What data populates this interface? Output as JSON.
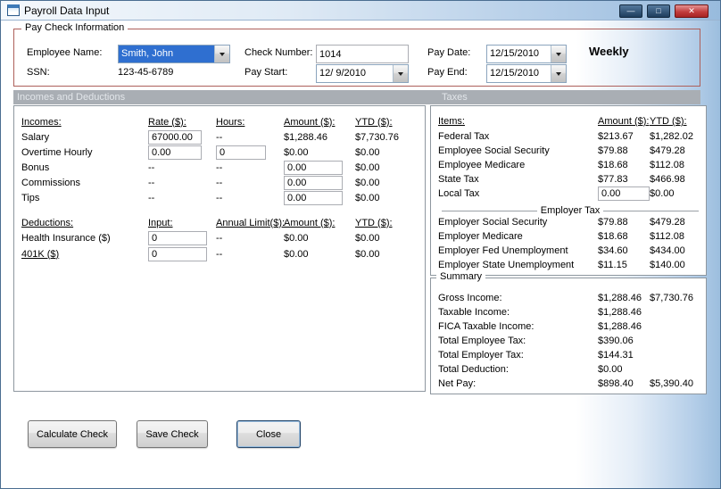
{
  "window": {
    "title": "Payroll Data Input"
  },
  "icons": {
    "minimize": "—",
    "maximize": "□",
    "close": "✕"
  },
  "paycheck": {
    "group_label": "Pay Check Information",
    "employee_name_label": "Employee Name:",
    "employee_name_value": "Smith, John",
    "ssn_label": "SSN:",
    "ssn_value": "123-45-6789",
    "check_number_label": "Check Number:",
    "check_number_value": "1014",
    "pay_start_label": "Pay Start:",
    "pay_start_value": "12/ 9/2010",
    "pay_date_label": "Pay Date:",
    "pay_date_value": "12/15/2010",
    "pay_end_label": "Pay End:",
    "pay_end_value": "12/15/2010",
    "frequency": "Weekly"
  },
  "sections": {
    "incomes_deductions": "Incomes and Deductions",
    "taxes": "Taxes"
  },
  "incomes": {
    "headers": [
      "Incomes:",
      "Rate ($):",
      "Hours:",
      "Amount ($):",
      "YTD ($):"
    ],
    "salary": {
      "label": "Salary",
      "rate": "67000.00",
      "hours": "--",
      "amount": "$1,288.46",
      "ytd": "$7,730.76"
    },
    "overtime": {
      "label": "Overtime Hourly",
      "rate": "0.00",
      "hours": "0",
      "amount": "$0.00",
      "ytd": "$0.00"
    },
    "bonus": {
      "label": "Bonus",
      "rate": "--",
      "hours": "--",
      "amount": "0.00",
      "ytd": "$0.00"
    },
    "commissions": {
      "label": "Commissions",
      "rate": "--",
      "hours": "--",
      "amount": "0.00",
      "ytd": "$0.00"
    },
    "tips": {
      "label": "Tips",
      "rate": "--",
      "hours": "--",
      "amount": "0.00",
      "ytd": "$0.00"
    }
  },
  "deductions": {
    "headers": [
      "Deductions:",
      "Input:",
      "Annual Limit($):",
      "Amount ($):",
      "YTD ($):"
    ],
    "health": {
      "label": "Health Insurance ($)",
      "input": "0",
      "limit": "--",
      "amount": "$0.00",
      "ytd": "$0.00"
    },
    "k401": {
      "label": "401K ($)",
      "input": "0",
      "limit": "--",
      "amount": "$0.00",
      "ytd": "$0.00"
    }
  },
  "taxes": {
    "headers": [
      "Items:",
      "Amount ($):",
      "YTD ($):"
    ],
    "rows": [
      {
        "label": "Federal Tax",
        "amount": "$213.67",
        "ytd": "$1,282.02"
      },
      {
        "label": "Employee Social Security",
        "amount": "$79.88",
        "ytd": "$479.28"
      },
      {
        "label": "Employee Medicare",
        "amount": "$18.68",
        "ytd": "$112.08"
      },
      {
        "label": "State Tax",
        "amount": "$77.83",
        "ytd": "$466.98"
      }
    ],
    "local_tax": {
      "label": "Local Tax",
      "amount": "0.00",
      "ytd": "$0.00"
    },
    "employer_header": "Employer Tax",
    "employer_rows": [
      {
        "label": "Employer Social Security",
        "amount": "$79.88",
        "ytd": "$479.28"
      },
      {
        "label": "Employer Medicare",
        "amount": "$18.68",
        "ytd": "$112.08"
      },
      {
        "label": "Employer Fed Unemployment",
        "amount": "$34.60",
        "ytd": "$434.00"
      },
      {
        "label": "Employer State Unemployment",
        "amount": "$11.15",
        "ytd": "$140.00"
      }
    ]
  },
  "summary": {
    "group_label": "Summary",
    "rows": [
      {
        "label": "Gross Income:",
        "amount": "$1,288.46",
        "ytd": "$7,730.76"
      },
      {
        "label": "Taxable Income:",
        "amount": "$1,288.46",
        "ytd": ""
      },
      {
        "label": "FICA Taxable Income:",
        "amount": "$1,288.46",
        "ytd": ""
      },
      {
        "label": "Total Employee Tax:",
        "amount": "$390.06",
        "ytd": ""
      },
      {
        "label": "Total Employer Tax:",
        "amount": "$144.31",
        "ytd": ""
      },
      {
        "label": "Total Deduction:",
        "amount": "$0.00",
        "ytd": ""
      },
      {
        "label": "Net Pay:",
        "amount": "$898.40",
        "ytd": "$5,390.40"
      }
    ]
  },
  "buttons": {
    "calculate": "Calculate Check",
    "save": "Save Check",
    "close": "Close"
  }
}
